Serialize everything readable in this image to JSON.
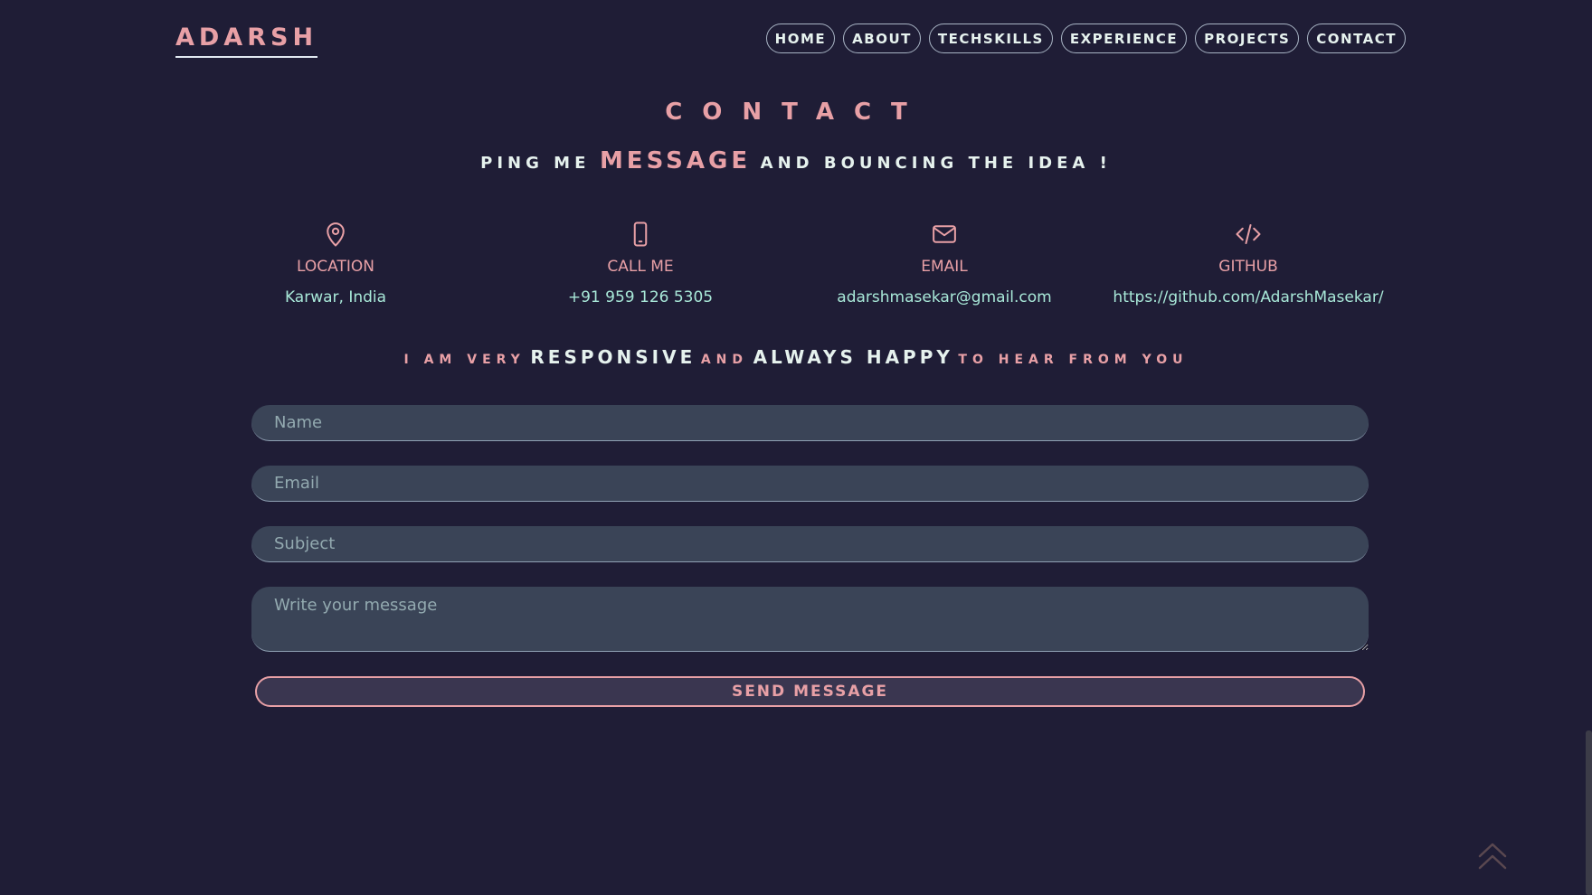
{
  "header": {
    "brand": "ADARSH",
    "nav": [
      "HOME",
      "ABOUT",
      "TECHSKILLS",
      "EXPERIENCE",
      "PROJECTS",
      "CONTACT"
    ]
  },
  "contact": {
    "title": "CONTACT",
    "subtitle": {
      "part1": "PING ME",
      "highlight": "MESSAGE",
      "part2": "AND BOUNCING THE IDEA !"
    },
    "info": [
      {
        "icon": "location-pin-icon",
        "label": "LOCATION",
        "value": "Karwar, India"
      },
      {
        "icon": "phone-icon",
        "label": "CALL ME",
        "value": "+91 959 126 5305"
      },
      {
        "icon": "mail-icon",
        "label": "EMAIL",
        "value": "adarshmasekar@gmail.com"
      },
      {
        "icon": "code-icon",
        "label": "GITHUB",
        "value": "https://github.com/AdarshMasekar/"
      }
    ],
    "tagline": {
      "p1": "I AM VERY",
      "b1": "RESPONSIVE",
      "p2": "AND",
      "b2": "ALWAYS HAPPY",
      "p3": "TO HEAR FROM YOU"
    },
    "form": {
      "name_placeholder": "Name",
      "email_placeholder": "Email",
      "subject_placeholder": "Subject",
      "message_placeholder": "Write your message",
      "send_label": "SEND MESSAGE"
    }
  },
  "colors": {
    "background": "#1f1d36",
    "accent_pink": "#e8a0a6",
    "accent_mint": "#a8e8d8",
    "field_bg": "#3a4457"
  }
}
